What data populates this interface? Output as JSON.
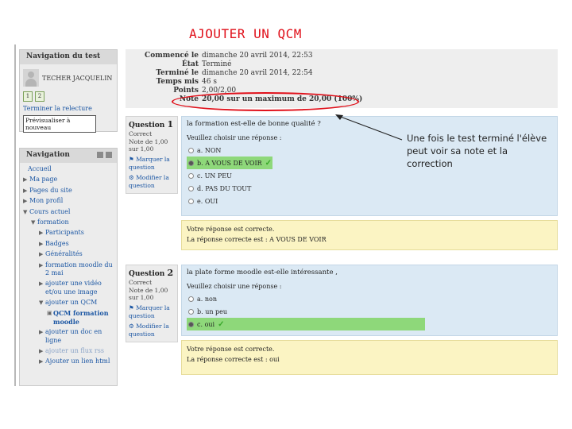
{
  "slide": {
    "title": "AJOUTER UN QCM",
    "annotation": "Une fois le test terminé l'élève peut voir sa note et la correction"
  },
  "colors": {
    "title_red": "#e0101a",
    "question_blue": "#dbe9f4",
    "feedback_yellow": "#fbf4c3",
    "correct_green": "#8ed87a"
  },
  "nav_test": {
    "header": "Navigation du test",
    "user": "TECHER JACQUELIN",
    "question_numbers": [
      "1",
      "2"
    ],
    "finish_link": "Terminer la relecture",
    "preview_button": "Prévisualiser à nouveau"
  },
  "nav_main": {
    "header": "Navigation",
    "items": [
      {
        "label": "Accueil",
        "arrow": ""
      },
      {
        "label": "Ma page",
        "arrow": "▶"
      },
      {
        "label": "Pages du site",
        "arrow": "▶"
      },
      {
        "label": "Mon profil",
        "arrow": "▶"
      },
      {
        "label": "Cours actuel",
        "arrow": "▼"
      },
      {
        "label": "formation",
        "arrow": "▼"
      },
      {
        "label": "Participants",
        "arrow": "▶"
      },
      {
        "label": "Badges",
        "arrow": "▶"
      },
      {
        "label": "Généralités",
        "arrow": "▶"
      },
      {
        "label": "formation moodle du 2 mai",
        "arrow": "▶"
      },
      {
        "label": "ajouter une vidéo et/ou une image",
        "arrow": "▶"
      },
      {
        "label": "ajouter un QCM",
        "arrow": "▼"
      },
      {
        "label": "QCM formation moodle",
        "arrow": "▣"
      },
      {
        "label": "ajouter un doc en ligne",
        "arrow": "▶"
      },
      {
        "label": "ajouter un flux rss",
        "arrow": "▶"
      },
      {
        "label": "Ajouter un lien html",
        "arrow": "▶"
      }
    ]
  },
  "summary": {
    "rows": [
      {
        "label": "Commencé le",
        "value": "dimanche 20 avril 2014, 22:53"
      },
      {
        "label": "État",
        "value": "Terminé"
      },
      {
        "label": "Terminé le",
        "value": "dimanche 20 avril 2014, 22:54"
      },
      {
        "label": "Temps mis",
        "value": "46 s"
      },
      {
        "label": "Points",
        "value": "2,00/2,00"
      },
      {
        "label": "Note",
        "value": "20,00 sur un maximum de 20,00 (100%)"
      }
    ]
  },
  "questions": [
    {
      "info_title": "Question",
      "info_number": "1",
      "status": "Correct",
      "mark": "Note de 1,00 sur 1,00",
      "flag": "Marquer la question",
      "edit": "Modifier la question",
      "text": "la formation est-elle de bonne qualité ?",
      "prompt": "Veuillez choisir une réponse :",
      "options": [
        "a. NON",
        "b. A VOUS DE VOIR",
        "c. UN PEU",
        "d. PAS DU TOUT",
        "e. OUI"
      ],
      "feedback_correct": "Votre réponse est correcte.",
      "feedback_answer": "La réponse correcte est : A VOUS DE VOIR"
    },
    {
      "info_title": "Question",
      "info_number": "2",
      "status": "Correct",
      "mark": "Note de 1,00 sur 1,00",
      "flag": "Marquer la question",
      "edit": "Modifier la question",
      "text": "la plate forme moodle est-elle intéressante ,",
      "prompt": "Veuillez choisir une réponse :",
      "options": [
        "a. non",
        "b. un peu",
        "c. oui"
      ],
      "feedback_correct": "Votre réponse est correcte.",
      "feedback_answer": "La réponse correcte est : oui"
    }
  ]
}
